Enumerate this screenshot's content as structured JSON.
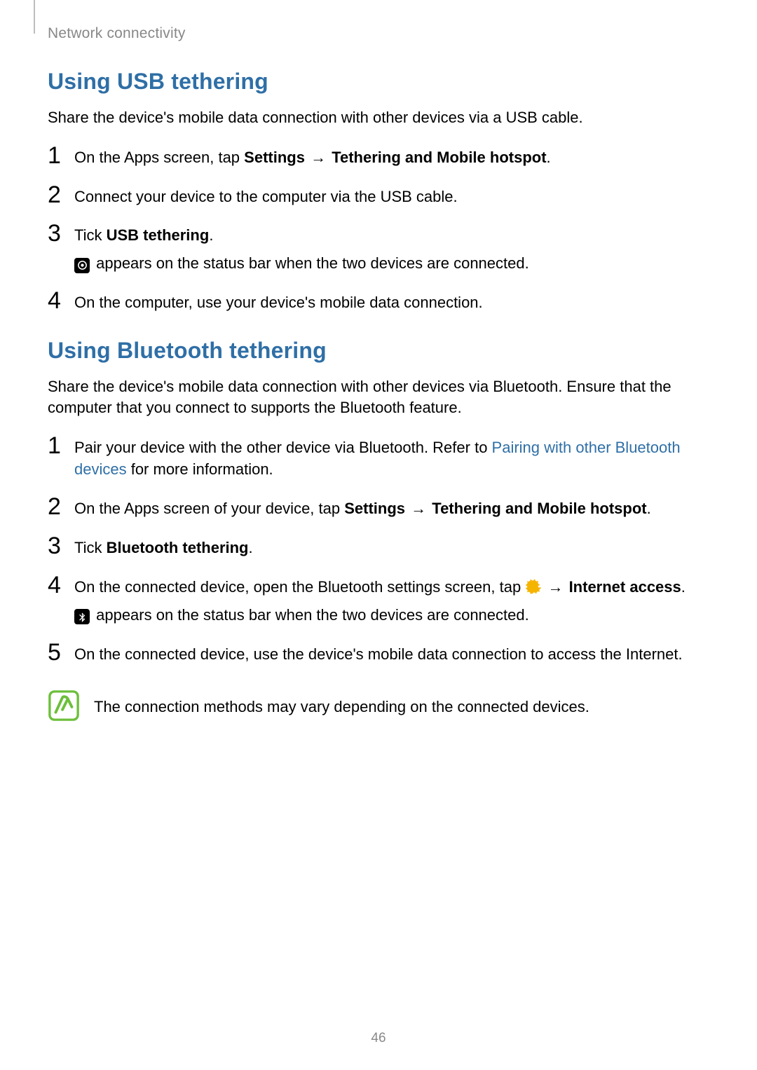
{
  "header": {
    "breadcrumb": "Network connectivity"
  },
  "page_number": "46",
  "section_usb": {
    "title": "Using USB tethering",
    "intro": "Share the device's mobile data connection with other devices via a USB cable.",
    "steps": [
      {
        "num": "1",
        "pre": "On the Apps screen, tap ",
        "b1": "Settings",
        "arrow1": " → ",
        "b2": "Tethering and Mobile hotspot",
        "post": "."
      },
      {
        "num": "2",
        "text": "Connect your device to the computer via the USB cable."
      },
      {
        "num": "3",
        "pre": "Tick ",
        "b1": "USB tethering",
        "post": ".",
        "sub": " appears on the status bar when the two devices are connected."
      },
      {
        "num": "4",
        "text": "On the computer, use your device's mobile data connection."
      }
    ]
  },
  "section_bt": {
    "title": "Using Bluetooth tethering",
    "intro": "Share the device's mobile data connection with other devices via Bluetooth. Ensure that the computer that you connect to supports the Bluetooth feature.",
    "steps": [
      {
        "num": "1",
        "pre": "Pair your device with the other device via Bluetooth. Refer to ",
        "link": "Pairing with other Bluetooth devices",
        "post": " for more information."
      },
      {
        "num": "2",
        "pre": "On the Apps screen of your device, tap ",
        "b1": "Settings",
        "arrow1": " → ",
        "b2": "Tethering and Mobile hotspot",
        "post": "."
      },
      {
        "num": "3",
        "pre": "Tick ",
        "b1": "Bluetooth tethering",
        "post": "."
      },
      {
        "num": "4",
        "pre": "On the connected device, open the Bluetooth settings screen, tap ",
        "arrow1": " → ",
        "b2": "Internet access",
        "post": ".",
        "sub": " appears on the status bar when the two devices are connected."
      },
      {
        "num": "5",
        "text": "On the connected device, use the device's mobile data connection to access the Internet."
      }
    ],
    "note": "The connection methods may vary depending on the connected devices."
  }
}
